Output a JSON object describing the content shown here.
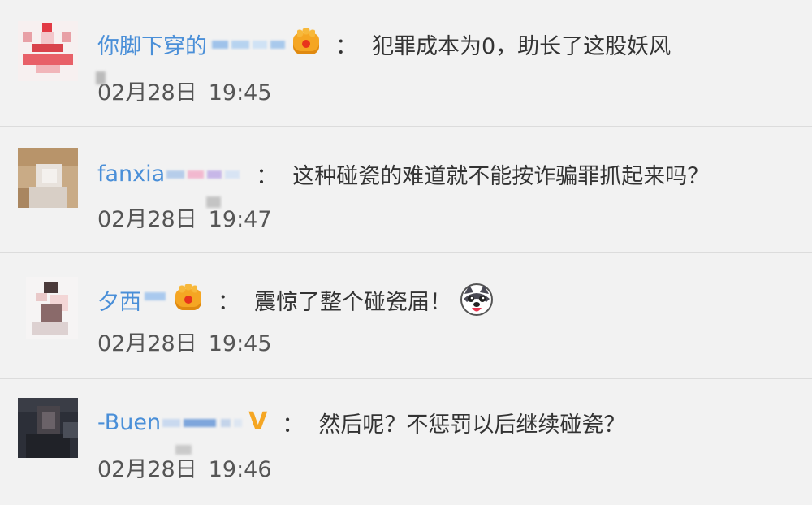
{
  "comments": [
    {
      "username": "你脚下穿的",
      "colon": "：",
      "text": "犯罪成本为0，助长了这股妖风",
      "date": "02月28日",
      "time": "19:45",
      "badge": "crown-icon"
    },
    {
      "username": "fanxia",
      "colon": "：",
      "text": "这种碰瓷的难道就不能按诈骗罪抓起来吗？",
      "date": "02月28日",
      "time": "19:47",
      "badge": ""
    },
    {
      "username": "夕西",
      "colon": "：",
      "text": "震惊了整个碰瓷届！",
      "date": "02月28日",
      "time": "19:45",
      "badge": "crown-icon",
      "emoji": "husky-emoji-icon"
    },
    {
      "username": "-Buen",
      "colon": "：",
      "text": "然后呢？不惩罚以后继续碰瓷？",
      "date": "02月28日",
      "time": "19:46",
      "badge": "v-badge-icon",
      "badge_text": "V"
    }
  ],
  "colors": {
    "background": "#f2f2f2",
    "username": "#4a8fd8",
    "text": "#333333",
    "badge_gold": "#f5a623",
    "divider": "#dcdcdc"
  }
}
